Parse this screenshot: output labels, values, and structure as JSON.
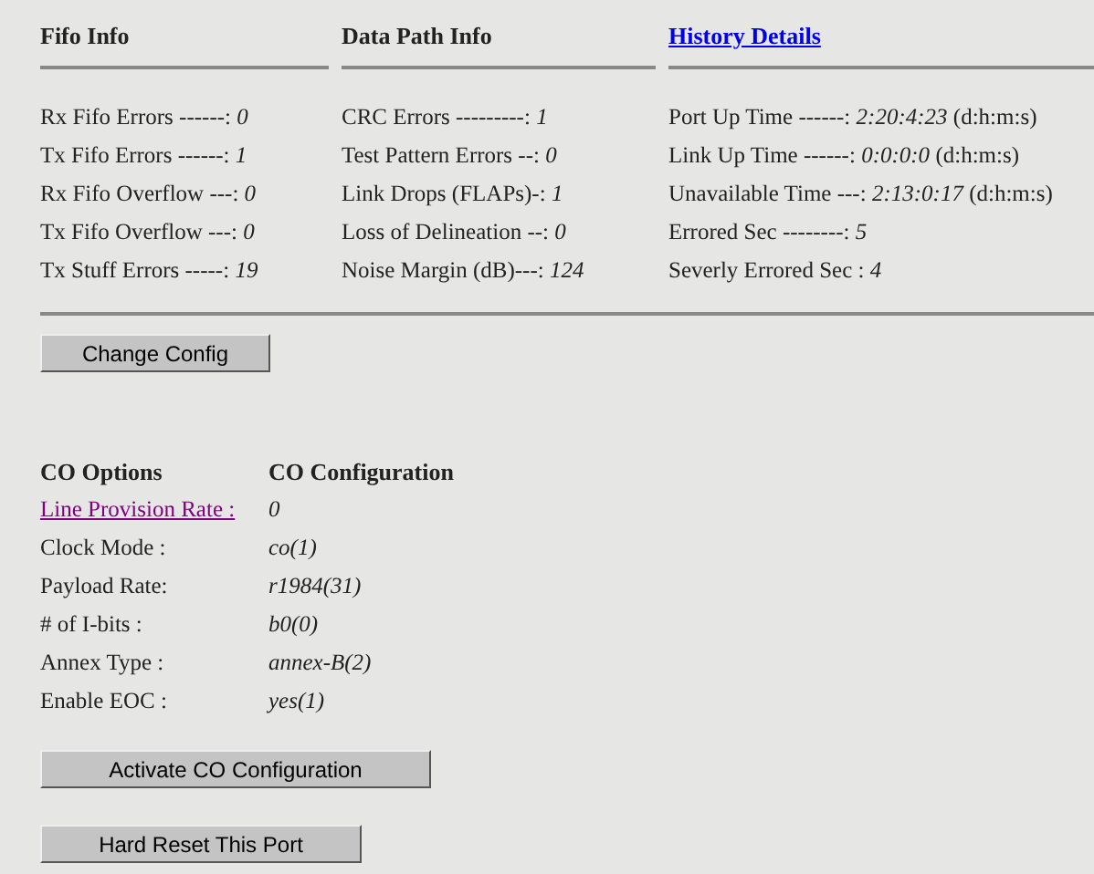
{
  "stats_sections": [
    {
      "title": "Fifo Info",
      "link": false,
      "rows": [
        {
          "label": "Rx Fifo Errors ------:",
          "value": "0"
        },
        {
          "label": "Tx Fifo Errors ------:",
          "value": "1"
        },
        {
          "label": "Rx Fifo Overflow ---:",
          "value": "0"
        },
        {
          "label": "Tx Fifo Overflow ---:",
          "value": "0"
        },
        {
          "label": "Tx Stuff Errors -----:",
          "value": "19"
        }
      ]
    },
    {
      "title": "Data Path Info",
      "link": false,
      "rows": [
        {
          "label": "CRC Errors ---------:",
          "value": "1"
        },
        {
          "label": "Test Pattern Errors --:",
          "value": "0"
        },
        {
          "label": "Link Drops (FLAPs)-:",
          "value": "1"
        },
        {
          "label": "Loss of Delineation --:",
          "value": "0"
        },
        {
          "label": "Noise Margin (dB)---:",
          "value": "124"
        }
      ]
    },
    {
      "title": "History Details",
      "link": true,
      "rows": [
        {
          "label": "Port Up Time ------:",
          "value": "2:20:4:23",
          "unit": "(d:h:m:s)"
        },
        {
          "label": "Link Up Time ------:",
          "value": "0:0:0:0",
          "unit": "(d:h:m:s)"
        },
        {
          "label": "Unavailable Time ---:",
          "value": "2:13:0:17",
          "unit": "(d:h:m:s)"
        },
        {
          "label": "Errored Sec --------:",
          "value": "5"
        },
        {
          "label": "Severly Errored Sec :",
          "value": "4"
        }
      ]
    }
  ],
  "change_button": "Change Config",
  "co": {
    "headers": [
      "CO Options",
      "CO Configuration"
    ],
    "rows": [
      {
        "label": "Line Provision Rate :",
        "value": "0",
        "link": true
      },
      {
        "label": "Clock Mode :",
        "value": "co(1)",
        "link": false
      },
      {
        "label": "Payload Rate:",
        "value": "r1984(31)",
        "link": false
      },
      {
        "label": "# of I-bits :",
        "value": "b0(0)",
        "link": false
      },
      {
        "label": "Annex Type :",
        "value": "annex-B(2)",
        "link": false
      },
      {
        "label": "Enable EOC :",
        "value": "yes(1)",
        "link": false
      }
    ]
  },
  "buttons": [
    "Activate CO Configuration",
    "Hard Reset This Port"
  ]
}
